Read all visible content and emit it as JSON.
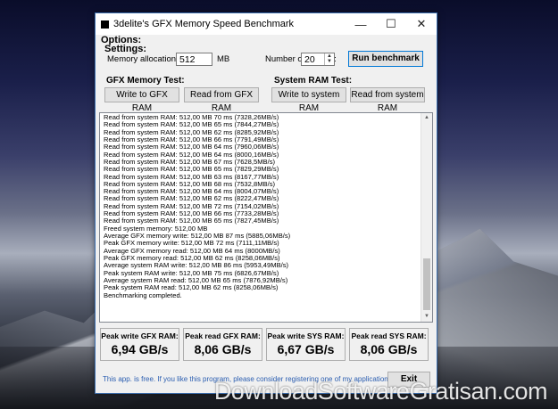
{
  "window": {
    "title": "3delite's GFX Memory Speed Benchmark",
    "controls": [
      "—",
      "☐",
      "✕"
    ]
  },
  "options": {
    "heading": "Options:",
    "settings_label": "Settings:",
    "alloc_label": "Memory allocation size:",
    "alloc_value": "512",
    "alloc_unit": "MB",
    "passes_label": "Number of passes:",
    "passes_value": "20",
    "run_button": "Run benchmark"
  },
  "gfx_test": {
    "heading": "GFX Memory Test:",
    "write_button": "Write to GFX RAM",
    "read_button": "Read from GFX RAM"
  },
  "sys_test": {
    "heading": "System RAM Test:",
    "write_button": "Write to system RAM",
    "read_button": "Read from system RAM"
  },
  "log": [
    "Read from system RAM: 512,00 MB 70 ms (7328,26MB/s)",
    "Read from system RAM: 512,00 MB 65 ms (7844,27MB/s)",
    "Read from system RAM: 512,00 MB 62 ms (8285,92MB/s)",
    "Read from system RAM: 512,00 MB 66 ms (7791,49MB/s)",
    "Read from system RAM: 512,00 MB 64 ms (7960,06MB/s)",
    "Read from system RAM: 512,00 MB 64 ms (8000,16MB/s)",
    "Read from system RAM: 512,00 MB 67 ms (7628,5MB/s)",
    "Read from system RAM: 512,00 MB 65 ms (7829,29MB/s)",
    "Read from system RAM: 512,00 MB 63 ms (8167,77MB/s)",
    "Read from system RAM: 512,00 MB 68 ms (7532,8MB/s)",
    "Read from system RAM: 512,00 MB 64 ms (8004,07MB/s)",
    "Read from system RAM: 512,00 MB 62 ms (8222,47MB/s)",
    "Read from system RAM: 512,00 MB 72 ms (7154,02MB/s)",
    "Read from system RAM: 512,00 MB 66 ms (7733,28MB/s)",
    "Read from system RAM: 512,00 MB 65 ms (7827,45MB/s)",
    "Freed system memory: 512,00 MB",
    "Average GFX memory write: 512,00 MB 87 ms (5885,06MB/s)",
    "Peak GFX memory write: 512,00 MB 72 ms (7111,11MB/s)",
    "Average GFX memory read: 512,00 MB 64 ms (8000MB/s)",
    "Peak GFX memory read: 512,00 MB 62 ms (8258,06MB/s)",
    "Average system RAM write: 512,00 MB 86 ms (5953,49MB/s)",
    "Peak system RAM write: 512,00 MB 75 ms (6826,67MB/s)",
    "Average system RAM read: 512,00 MB 65 ms (7876,92MB/s)",
    "Peak system RAM read: 512,00 MB 62 ms (8258,06MB/s)",
    "Benchmarking completed."
  ],
  "stats": [
    {
      "label": "Peak write GFX RAM:",
      "value": "6,94 GB/s"
    },
    {
      "label": "Peak read GFX RAM:",
      "value": "8,06 GB/s"
    },
    {
      "label": "Peak write SYS RAM:",
      "value": "6,67 GB/s"
    },
    {
      "label": "Peak read SYS RAM:",
      "value": "8,06 GB/s"
    }
  ],
  "footer": {
    "text": "This app. is free. If you like this program, please consider registering one of my applications...",
    "exit_button": "Exit"
  },
  "watermark": "DownloadSoftwareGratisan.com",
  "colors": {
    "accent": "#0078d7",
    "link": "#2a5db0"
  }
}
